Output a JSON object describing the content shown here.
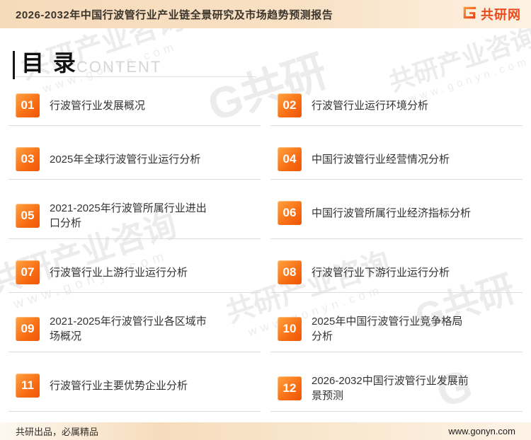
{
  "header": {
    "title": "2026-2032年中国行波管行业产业链全景研究及市场趋势预测报告",
    "logo_text": "共研网"
  },
  "toc": {
    "title": "目 录",
    "subtitle": "CONTENT",
    "items": [
      {
        "num": "01",
        "label": "行波管行业发展概况"
      },
      {
        "num": "02",
        "label": "行波管行业运行环境分析"
      },
      {
        "num": "03",
        "label": "2025年全球行波管行业运行分析"
      },
      {
        "num": "04",
        "label": "中国行波管行业经营情况分析"
      },
      {
        "num": "05",
        "label": "2021-2025年行波管所属行业进出口分析"
      },
      {
        "num": "06",
        "label": "中国行波管所属行业经济指标分析"
      },
      {
        "num": "07",
        "label": "行波管行业上游行业运行分析"
      },
      {
        "num": "08",
        "label": "行波管行业下游行业运行分析"
      },
      {
        "num": "09",
        "label": "2021-2025年行波管行业各区域市场概况"
      },
      {
        "num": "10",
        "label": "2025年中国行波管行业竞争格局分析"
      },
      {
        "num": "11",
        "label": "行波管行业主要优势企业分析"
      },
      {
        "num": "12",
        "label": "2026-2032中国行波管行业发展前景预测"
      }
    ]
  },
  "footer": {
    "left": "共研出品，必属精品",
    "right": "www.gonyn.com"
  },
  "watermarks": {
    "brand": "共研产业咨询",
    "url": "www.gonyn.com",
    "g_brand": "G共研",
    "g": "G"
  },
  "colors": {
    "accent_from": "#ffa341",
    "accent_to": "#ef5506",
    "logo_red": "#e84b1e",
    "header_bg_from": "#f6dbba",
    "header_bg_to": "#fdf2e3",
    "divider": "#dcdcdc",
    "text": "#333333"
  }
}
